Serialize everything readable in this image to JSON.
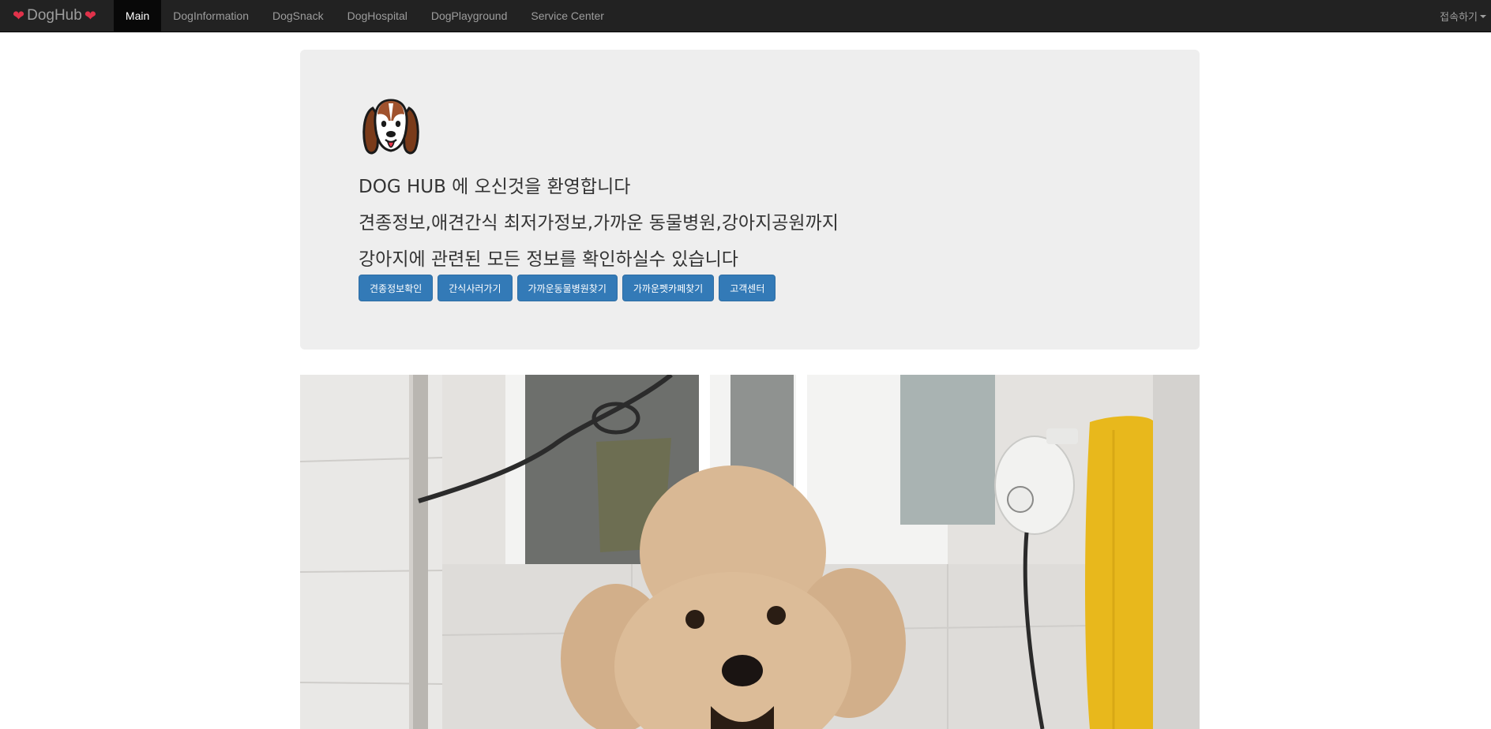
{
  "navbar": {
    "brand": "DogHub",
    "items": [
      {
        "label": "Main",
        "active": true
      },
      {
        "label": "DogInformation",
        "active": false
      },
      {
        "label": "DogSnack",
        "active": false
      },
      {
        "label": "DogHospital",
        "active": false
      },
      {
        "label": "DogPlayground",
        "active": false
      },
      {
        "label": "Service Center",
        "active": false
      }
    ],
    "right_menu": "접속하기"
  },
  "hero": {
    "logo_icon": "beagle-face-icon",
    "line1": "DOG HUB 에 오신것을 환영합니다",
    "line2": "견종정보,애견간식 최저가정보,가까운 동물병원,강아지공원까지",
    "line3": "강아지에 관련된 모든 정보를 확인하실수 있습니다",
    "buttons": [
      "견종정보확인",
      "간식사러가기",
      "가까운동물병원찾기",
      "가까운펫카페찾기",
      "고객센터"
    ]
  },
  "colors": {
    "navbar_bg": "#222222",
    "nav_text": "#9d9d9d",
    "brand_heart": "#e0324a",
    "jumbotron_bg": "#eeeeee",
    "button_primary": "#337ab7"
  }
}
